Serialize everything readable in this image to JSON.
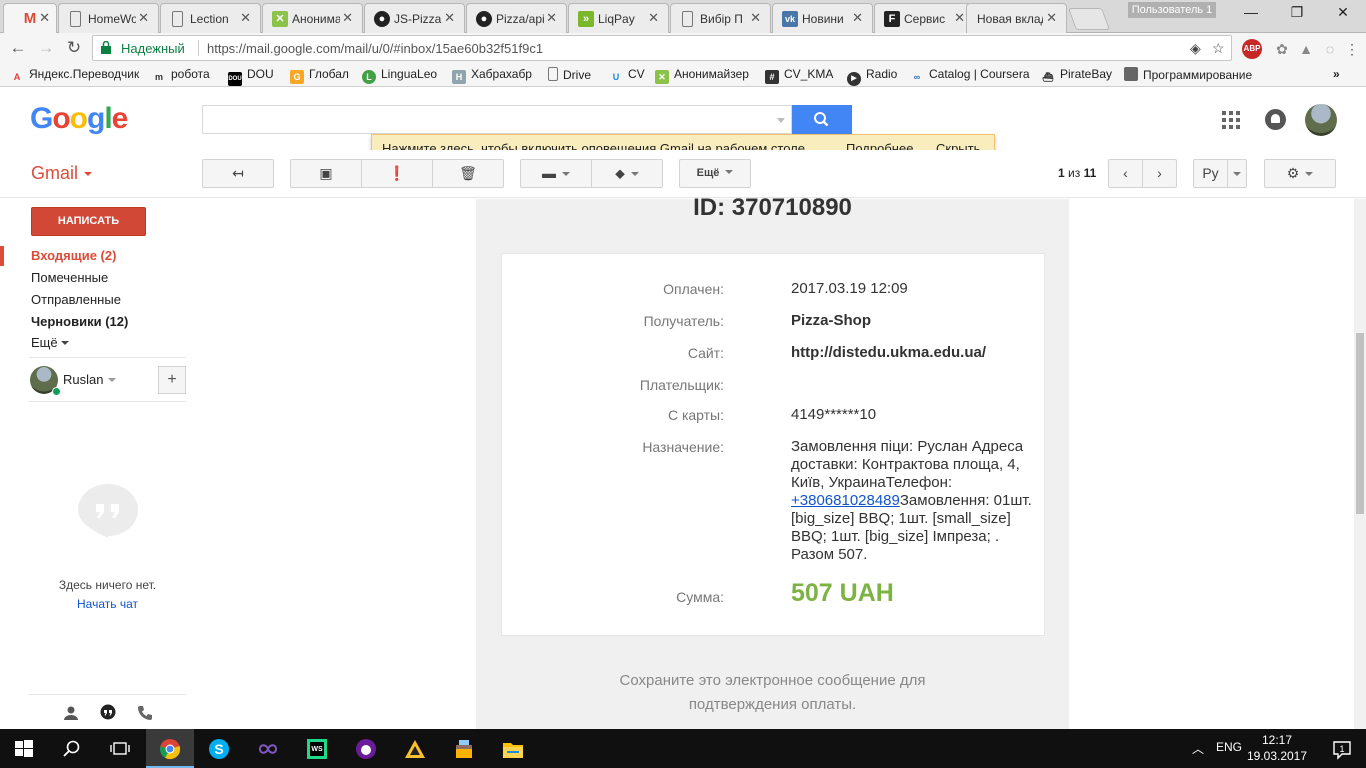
{
  "browser": {
    "tabs": [
      {
        "label": "Gmail",
        "icon": "gmail-icon",
        "active": true
      },
      {
        "label": "HomeWork",
        "icon": "document-icon"
      },
      {
        "label": "Lection",
        "icon": "document-icon"
      },
      {
        "label": "Анонимайзер",
        "icon": "anonymizer-icon"
      },
      {
        "label": "JS-Pizza",
        "icon": "github-icon"
      },
      {
        "label": "Pizza/api",
        "icon": "github-icon"
      },
      {
        "label": "LiqPay",
        "icon": "liqpay-icon"
      },
      {
        "label": "Вибір П",
        "icon": "document-icon"
      },
      {
        "label": "Новини",
        "icon": "vk-icon"
      },
      {
        "label": "Сервис",
        "icon": "f-icon"
      },
      {
        "label": "Новая вкладка",
        "icon": "none"
      }
    ],
    "profile_label": "Пользователь 1",
    "secure_label": "Надежный",
    "url": "https://mail.google.com/mail/u/0/#inbox/15ae60b32f51f9c1",
    "bookmarks": [
      "Яндекс.Переводчик",
      "робота",
      "DOU",
      "Глобал",
      "LinguaLeo",
      "Хабрахабр",
      "Drive",
      "CV",
      "Анонимайзер",
      "CV_KMA",
      "Radio",
      "Catalog | Coursera",
      "PirateBay",
      "Программирование"
    ],
    "bookmarks_overflow": "»"
  },
  "gmail": {
    "logo": "Google",
    "app_label": "Gmail",
    "notice": {
      "link": "Нажмите здесь",
      "text": ", чтобы включить оповещения Gmail на рабочем столе.",
      "more": "Подробнее...",
      "hide": "Скрыть"
    },
    "toolbar": {
      "more_label": "Ещё",
      "pager_current": "1",
      "pager_of": "из",
      "pager_total": "11",
      "lang_label": "Ру"
    },
    "compose_label": "НАПИСАТЬ",
    "nav": {
      "inbox": "Входящие (2)",
      "starred": "Помеченные",
      "sent": "Отправленные",
      "drafts": "Черновики (12)",
      "more": "Ещё"
    },
    "hangouts": {
      "user": "Ruslan",
      "add": "+",
      "empty": "Здесь ничего нет.",
      "start_chat": "Начать чат"
    }
  },
  "email": {
    "payment_id": "ID: 370710890",
    "rows": {
      "paid_label": "Оплачен:",
      "paid_value": "2017.03.19 12:09",
      "recipient_label": "Получатель:",
      "recipient_value": "Pizza-Shop",
      "site_label": "Сайт:",
      "site_value": "http://distedu.ukma.edu.ua/",
      "payer_label": "Плательщик:",
      "card_label": "С карты:",
      "card_value": "4149******10",
      "purpose_label": "Назначение:",
      "purpose_pre": "Замовлення піци: Руслан Адреса доставки: Контрактова площа, 4, Київ, УкраинаТелефон: ",
      "purpose_phone": "+380681028489",
      "purpose_post": "Замовлення: 01шт. [big_size] BBQ; 1шт. [small_size] BBQ; 1шт. [big_size] Імпреза; . Разом 507.",
      "amount_label": "Сумма:",
      "amount_value": "507 UAH"
    },
    "save_note": "Сохраните это электронное сообщение для подтверждения оплаты."
  },
  "taskbar": {
    "language": "ENG",
    "time": "12:17",
    "date": "19.03.2017",
    "notifications": "1"
  },
  "colors": {
    "gmail_red": "#dd4b39",
    "compose_red": "#d14836",
    "search_blue": "#4285f4",
    "amount_green": "#7cb342",
    "link_blue": "#1155cc",
    "notice_yellow": "#f9edbe"
  }
}
